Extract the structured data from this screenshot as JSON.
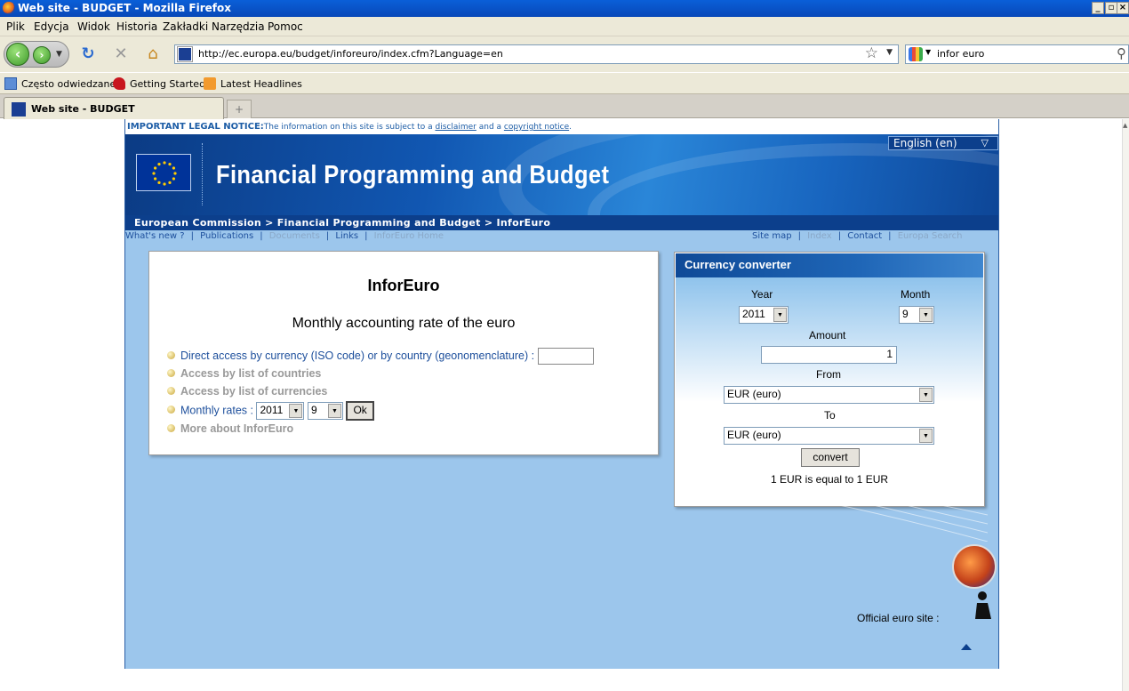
{
  "window": {
    "title": "Web site - BUDGET - Mozilla Firefox",
    "controls": [
      "_",
      "▫",
      "×"
    ]
  },
  "menu": [
    "Plik",
    "Edycja",
    "Widok",
    "Historia",
    "Zakładki",
    "Narzędzia",
    "Pomoc"
  ],
  "nav": {
    "url": "http://ec.europa.eu/budget/inforeuro/index.cfm?Language=en",
    "search_value": "infor euro"
  },
  "bookmarks": [
    "Często odwiedzane",
    "Getting Started",
    "Latest Headlines"
  ],
  "tab": {
    "label": "Web site - BUDGET",
    "new_tab": "+"
  },
  "page": {
    "legal": {
      "label": "IMPORTANT LEGAL NOTICE:",
      "text1": "The information on this site is subject to a ",
      "disclaimer": "disclaimer",
      "text2": " and a ",
      "copyright": "copyright notice",
      "text3": "."
    },
    "language": "English (en)",
    "site_title": "Financial Programming and Budget",
    "breadcrumb": "European Commission > Financial Programming and Budget > InforEuro",
    "links_left": [
      "What's new ?",
      "Publications",
      "Documents",
      "Links",
      "InforEuro Home"
    ],
    "links_right": [
      "Site map",
      "Index",
      "Contact",
      "Europa Search"
    ],
    "main": {
      "title": "InforEuro",
      "subtitle": "Monthly accounting rate of the euro",
      "opt_direct": "Direct access by currency (ISO code) or by country (geonomenclature) :",
      "opt_countries": "Access by list of countries",
      "opt_currencies": "Access by list of currencies",
      "opt_monthly": "Monthly rates :",
      "monthly_year": "2011",
      "monthly_month": "9",
      "ok": "Ok",
      "opt_more": "More about InforEuro"
    },
    "converter": {
      "header": "Currency converter",
      "year_label": "Year",
      "year_value": "2011",
      "month_label": "Month",
      "month_value": "9",
      "amount_label": "Amount",
      "amount_value": "1",
      "from_label": "From",
      "from_value": "EUR (euro)",
      "to_label": "To",
      "to_value": "EUR (euro)",
      "convert": "convert",
      "result": "1 EUR is equal to 1 EUR"
    },
    "official": "Official euro site :"
  }
}
